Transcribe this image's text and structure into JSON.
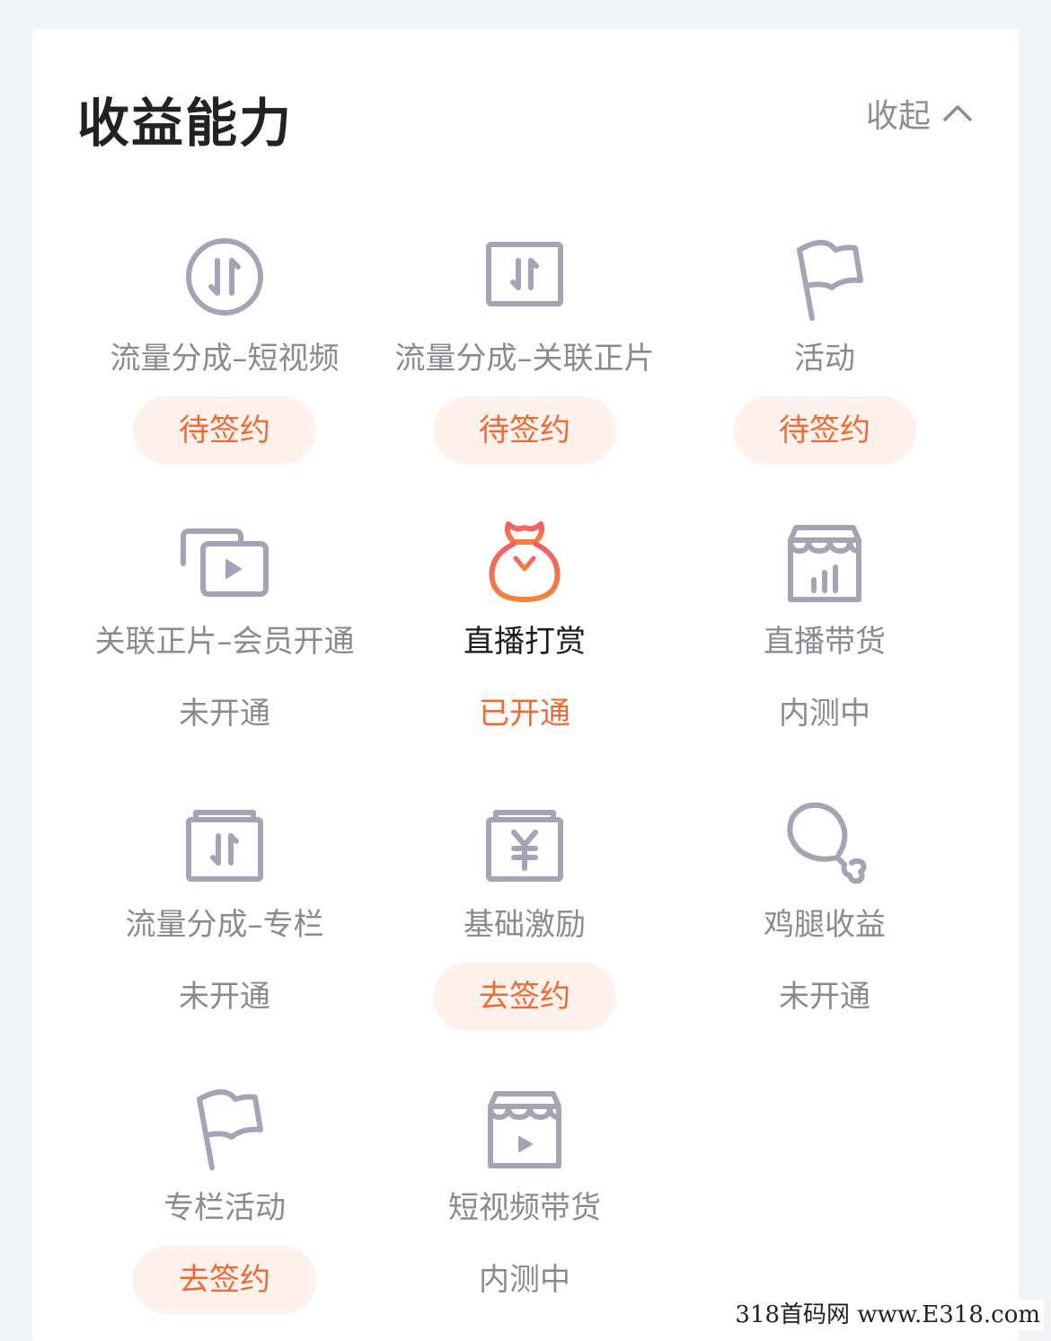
{
  "section": {
    "title": "收益能力",
    "collapse_label": "收起"
  },
  "items": [
    {
      "label": "流量分成–短视频",
      "status": "待签约",
      "status_style": "pill",
      "icon": "circle-transfer-icon"
    },
    {
      "label": "流量分成–关联正片",
      "status": "待签约",
      "status_style": "pill",
      "icon": "box-transfer-icon"
    },
    {
      "label": "活动",
      "status": "待签约",
      "status_style": "pill",
      "icon": "flag-icon"
    },
    {
      "label": "关联正片–会员开通",
      "status": "未开通",
      "status_style": "plain",
      "icon": "video-stack-icon"
    },
    {
      "label": "直播打赏",
      "status": "已开通",
      "status_style": "orange",
      "icon": "money-bag-icon"
    },
    {
      "label": "直播带货",
      "status": "内测中",
      "status_style": "plain",
      "icon": "shop-chart-icon"
    },
    {
      "label": "流量分成–专栏",
      "status": "未开通",
      "status_style": "plain",
      "icon": "folder-transfer-icon"
    },
    {
      "label": "基础激励",
      "status": "去签约",
      "status_style": "pill",
      "icon": "yuan-box-icon"
    },
    {
      "label": "鸡腿收益",
      "status": "未开通",
      "status_style": "plain",
      "icon": "drumstick-icon"
    },
    {
      "label": "专栏活动",
      "status": "去签约",
      "status_style": "pill",
      "icon": "flag-icon"
    },
    {
      "label": "短视频带货",
      "status": "内测中",
      "status_style": "plain",
      "icon": "shop-play-icon"
    }
  ],
  "colors": {
    "accent": "#ee6a35",
    "pill_bg": "#fff2ed",
    "icon_gray": "#a6a4b4",
    "text_gray": "#8a8a92",
    "title": "#222222"
  },
  "watermark": "318首码网 www.E318.com"
}
